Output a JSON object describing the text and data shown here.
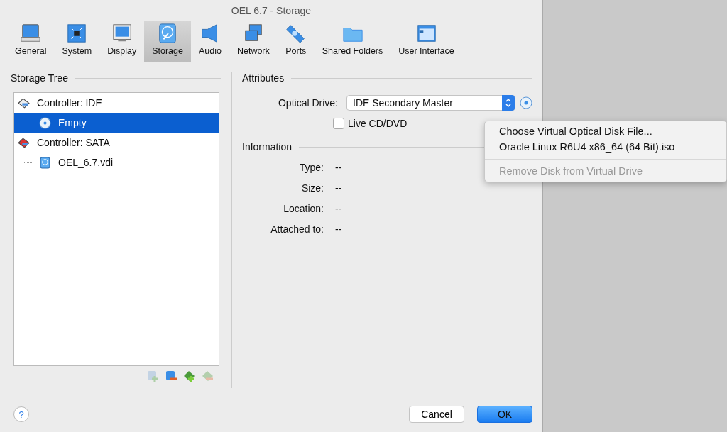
{
  "window": {
    "title": "OEL 6.7 - Storage"
  },
  "tabs": [
    {
      "label": "General",
      "selected": false
    },
    {
      "label": "System",
      "selected": false
    },
    {
      "label": "Display",
      "selected": false
    },
    {
      "label": "Storage",
      "selected": true
    },
    {
      "label": "Audio",
      "selected": false
    },
    {
      "label": "Network",
      "selected": false
    },
    {
      "label": "Ports",
      "selected": false
    },
    {
      "label": "Shared Folders",
      "selected": false
    },
    {
      "label": "User Interface",
      "selected": false
    }
  ],
  "storage_tree": {
    "title": "Storage Tree",
    "items": [
      {
        "kind": "controller",
        "label": "Controller: IDE",
        "selected": false,
        "children": [
          {
            "kind": "optical",
            "label": "Empty",
            "selected": true
          }
        ]
      },
      {
        "kind": "controller",
        "label": "Controller: SATA",
        "selected": false,
        "children": [
          {
            "kind": "disk",
            "label": "OEL_6.7.vdi",
            "selected": false
          }
        ]
      }
    ],
    "buttons": [
      {
        "kind": "add-attachment",
        "disabled": true
      },
      {
        "kind": "remove-attachment",
        "disabled": false
      },
      {
        "kind": "add-controller",
        "disabled": false
      },
      {
        "kind": "remove-controller",
        "disabled": true
      }
    ]
  },
  "attributes": {
    "title": "Attributes",
    "optical_drive": {
      "label": "Optical Drive:",
      "value": "IDE Secondary Master"
    },
    "live_cd": {
      "label": "Live CD/DVD",
      "checked": false
    }
  },
  "information": {
    "title": "Information",
    "rows": [
      {
        "label": "Type:",
        "value": "--"
      },
      {
        "label": "Size:",
        "value": "--"
      },
      {
        "label": "Location:",
        "value": "--"
      },
      {
        "label": "Attached to:",
        "value": "--"
      }
    ]
  },
  "menu": {
    "items": [
      {
        "label": "Choose Virtual Optical Disk File...",
        "disabled": false,
        "separator_before": false
      },
      {
        "label": "Oracle Linux R6U4 x86_64 (64 Bit).iso",
        "disabled": false,
        "separator_before": false
      },
      {
        "label": "Remove Disk from Virtual Drive",
        "disabled": true,
        "separator_before": true
      }
    ]
  },
  "help": {
    "label": "?"
  },
  "buttons": [
    {
      "label": "Cancel",
      "kind": "secondary"
    },
    {
      "label": "OK",
      "kind": "primary"
    }
  ]
}
